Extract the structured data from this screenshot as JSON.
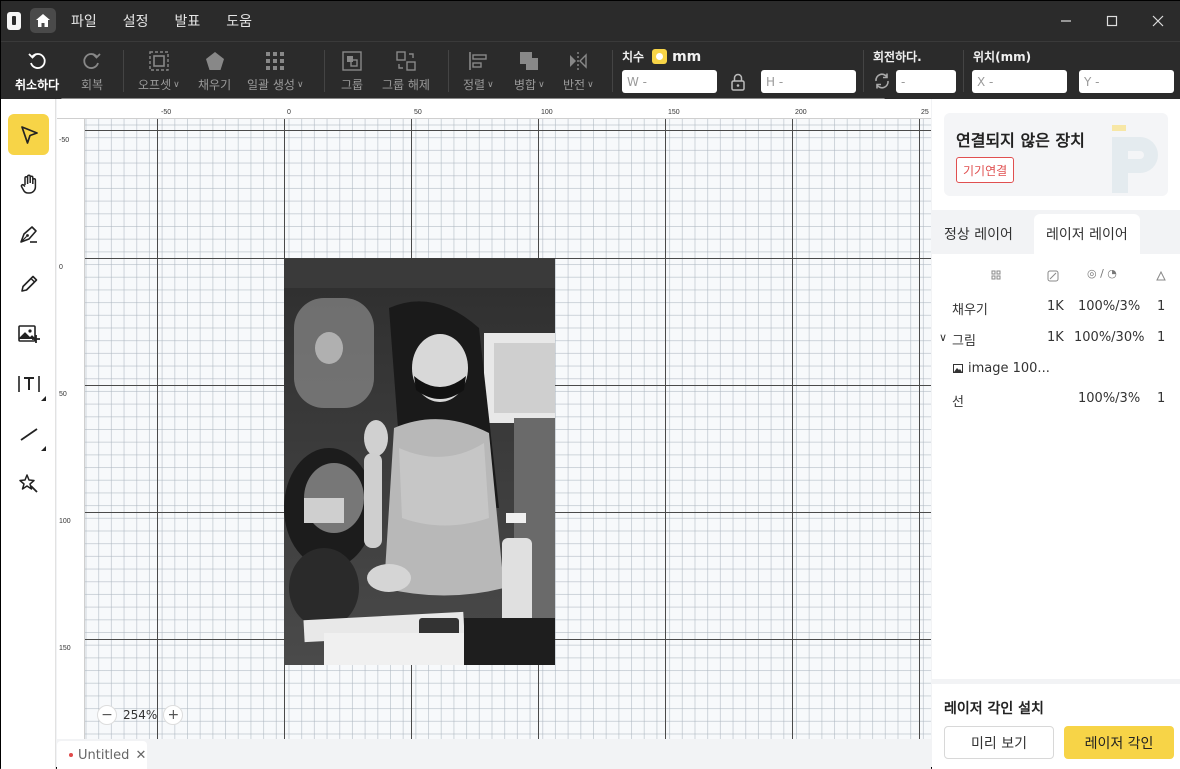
{
  "titlebar": {
    "menu": [
      "파일",
      "설정",
      "발표",
      "도움"
    ]
  },
  "toolbar": {
    "undo": "취소하다",
    "redo": "회복",
    "offset": "오프셋",
    "fill": "채우기",
    "batch": "일괄 생성",
    "group": "그룹",
    "ungroup": "그룹 해제",
    "align": "정렬",
    "merge": "병합",
    "flip": "반전",
    "size_label": "치수",
    "unit": "mm",
    "width_placeholder": "W -",
    "height_placeholder": "H -",
    "rotate_label": "회전하다.",
    "rotate_placeholder": "-",
    "position_label": "위치(mm)",
    "x_placeholder": "X -",
    "y_placeholder": "Y -"
  },
  "ruler": {
    "top": [
      "-50",
      "0",
      "50",
      "100",
      "150",
      "200",
      "25"
    ],
    "left": [
      "-50",
      "0",
      "50",
      "100",
      "150"
    ]
  },
  "canvas": {
    "zoom": "254%",
    "doc_tab": "Untitled"
  },
  "panel": {
    "device_status": "연결되지 않은 장치",
    "connect_button": "기기연결",
    "tabs": [
      "정상 레이어",
      "레이저 레이어"
    ],
    "active_tab": "레이저 레이어",
    "layers": [
      {
        "name": "채우기",
        "res": "1K",
        "power": "100%/3%",
        "passes": "1"
      },
      {
        "name": "그림",
        "res": "1K",
        "power": "100%/30%",
        "passes": "1"
      },
      {
        "name": "image 100...",
        "res": "",
        "power": "",
        "passes": ""
      },
      {
        "name": "선",
        "res": "",
        "power": "100%/3%",
        "passes": "1"
      }
    ],
    "laser_settings_title": "레이저 각인 설치",
    "preview_button": "미리 보기",
    "engrave_button": "레이저 각인"
  },
  "colors": {
    "accent": "#f7d447",
    "titlebar": "#2b2b2b",
    "connect_red": "#e05050"
  }
}
